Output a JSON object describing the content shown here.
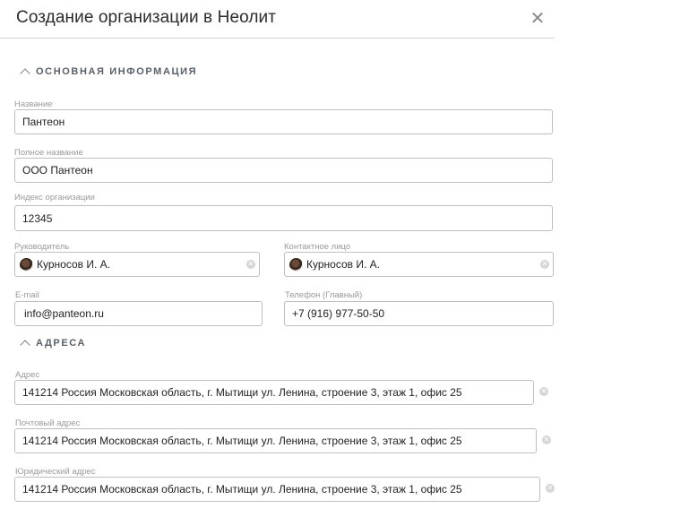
{
  "dialog": {
    "title": "Создание организации в Неолит",
    "close_glyph": "✕"
  },
  "sections": {
    "basic": "ОСНОВНАЯ ИНФОРМАЦИЯ",
    "addresses": "АДРЕСА"
  },
  "fields": {
    "name": {
      "label": "Название",
      "value": "Пантеон"
    },
    "full_name": {
      "label": "Полное название",
      "value": "ООО Пантеон"
    },
    "index": {
      "label": "Индекс организации",
      "value": "12345"
    },
    "manager": {
      "label": "Руководитель",
      "value": "Курносов И. А."
    },
    "contact": {
      "label": "Контактное лицо",
      "value": "Курносов И. А."
    },
    "email": {
      "label": "E-mail",
      "value": "info@panteon.ru"
    },
    "phone": {
      "label": "Телефон (Главный)",
      "value": "+7 (916) 977-50-50"
    },
    "address": {
      "label": "Адрес",
      "value": "141214 Россия Московская область, г. Мытищи ул. Ленина, строение 3, этаж 1, офис 25"
    },
    "postal_address": {
      "label": "Почтовый адрес",
      "value": "141214 Россия Московская область, г. Мытищи ул. Ленина, строение 3, этаж 1, офис 25"
    },
    "legal_address": {
      "label": "Юридический адрес",
      "value": "141214 Россия Московская область, г. Мытищи ул. Ленина, строение 3, этаж 1, офис 25"
    }
  },
  "icons": {
    "close": "close-icon",
    "collapse": "chevron-up-icon",
    "clear": "clear-icon",
    "avatar": "user-avatar"
  },
  "colors": {
    "border": "#bfbfbf",
    "section_text": "#5a6069",
    "label_text": "#9a9a9a"
  }
}
